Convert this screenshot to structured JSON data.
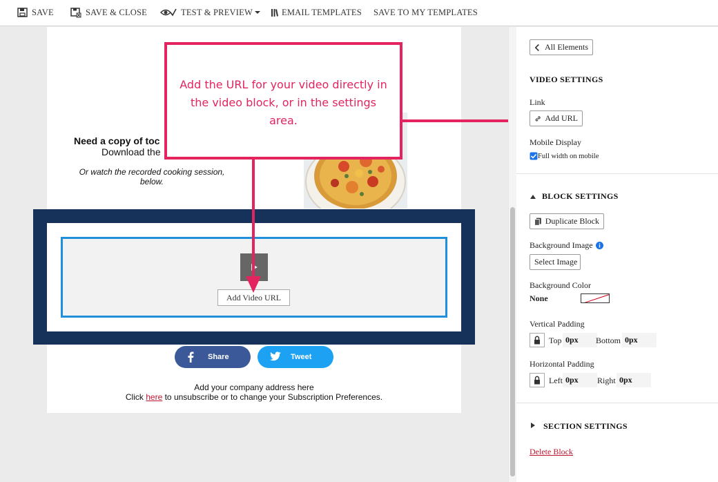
{
  "toolbar": {
    "save": "SAVE",
    "save_close": "SAVE & CLOSE",
    "test_preview": "TEST & PREVIEW",
    "email_templates": "EMAIL TEMPLATES",
    "save_to_templates": "SAVE TO MY TEMPLATES"
  },
  "email": {
    "promo_title": "Need a copy of toc",
    "promo_sub": "Download the",
    "promo_italic": "Or watch the recorded cooking session, below.",
    "add_video_url": "Add Video URL",
    "share": "Share",
    "tweet": "Tweet",
    "address": "Add your company address here",
    "unsub_prefix": "Click ",
    "unsub_link": "here",
    "unsub_suffix": " to unsubscribe or to change your Subscription Preferences."
  },
  "callout": {
    "text": "Add the URL for your video directly in the video block, or in the settings area."
  },
  "panel": {
    "all_elements": "All Elements",
    "video_settings": "VIDEO SETTINGS",
    "link_label": "Link",
    "add_url": "Add URL",
    "mobile_display": "Mobile Display",
    "full_width": "Full width on mobile",
    "block_settings": "BLOCK SETTINGS",
    "duplicate_block": "Duplicate Block",
    "background_image": "Background Image",
    "select_image": "Select Image",
    "background_color": "Background Color",
    "bg_color_value": "None",
    "vertical_padding": "Vertical Padding",
    "top_label": "Top",
    "top_value": "0px",
    "bottom_label": "Bottom",
    "bottom_value": "0px",
    "horizontal_padding": "Horizontal Padding",
    "left_label": "Left",
    "left_value": "0px",
    "right_label": "Right",
    "right_value": "0px",
    "section_settings": "SECTION SETTINGS",
    "delete_block": "Delete Block"
  },
  "colors": {
    "accent_pink": "#e3245f",
    "selection_blue": "#1e8fd8",
    "block_navy": "#17325a",
    "facebook": "#3b5998",
    "twitter": "#1da1f2",
    "link_red": "#c0152f"
  },
  "icons": [
    "save-icon",
    "save-close-icon",
    "eye-check-icon",
    "book-icon",
    "chevron-left-icon",
    "link-icon",
    "checkbox-icon",
    "triangle-down-icon",
    "triangle-right-icon",
    "duplicate-icon",
    "info-icon",
    "lock-icon",
    "play-icon",
    "facebook-icon",
    "twitter-icon"
  ]
}
